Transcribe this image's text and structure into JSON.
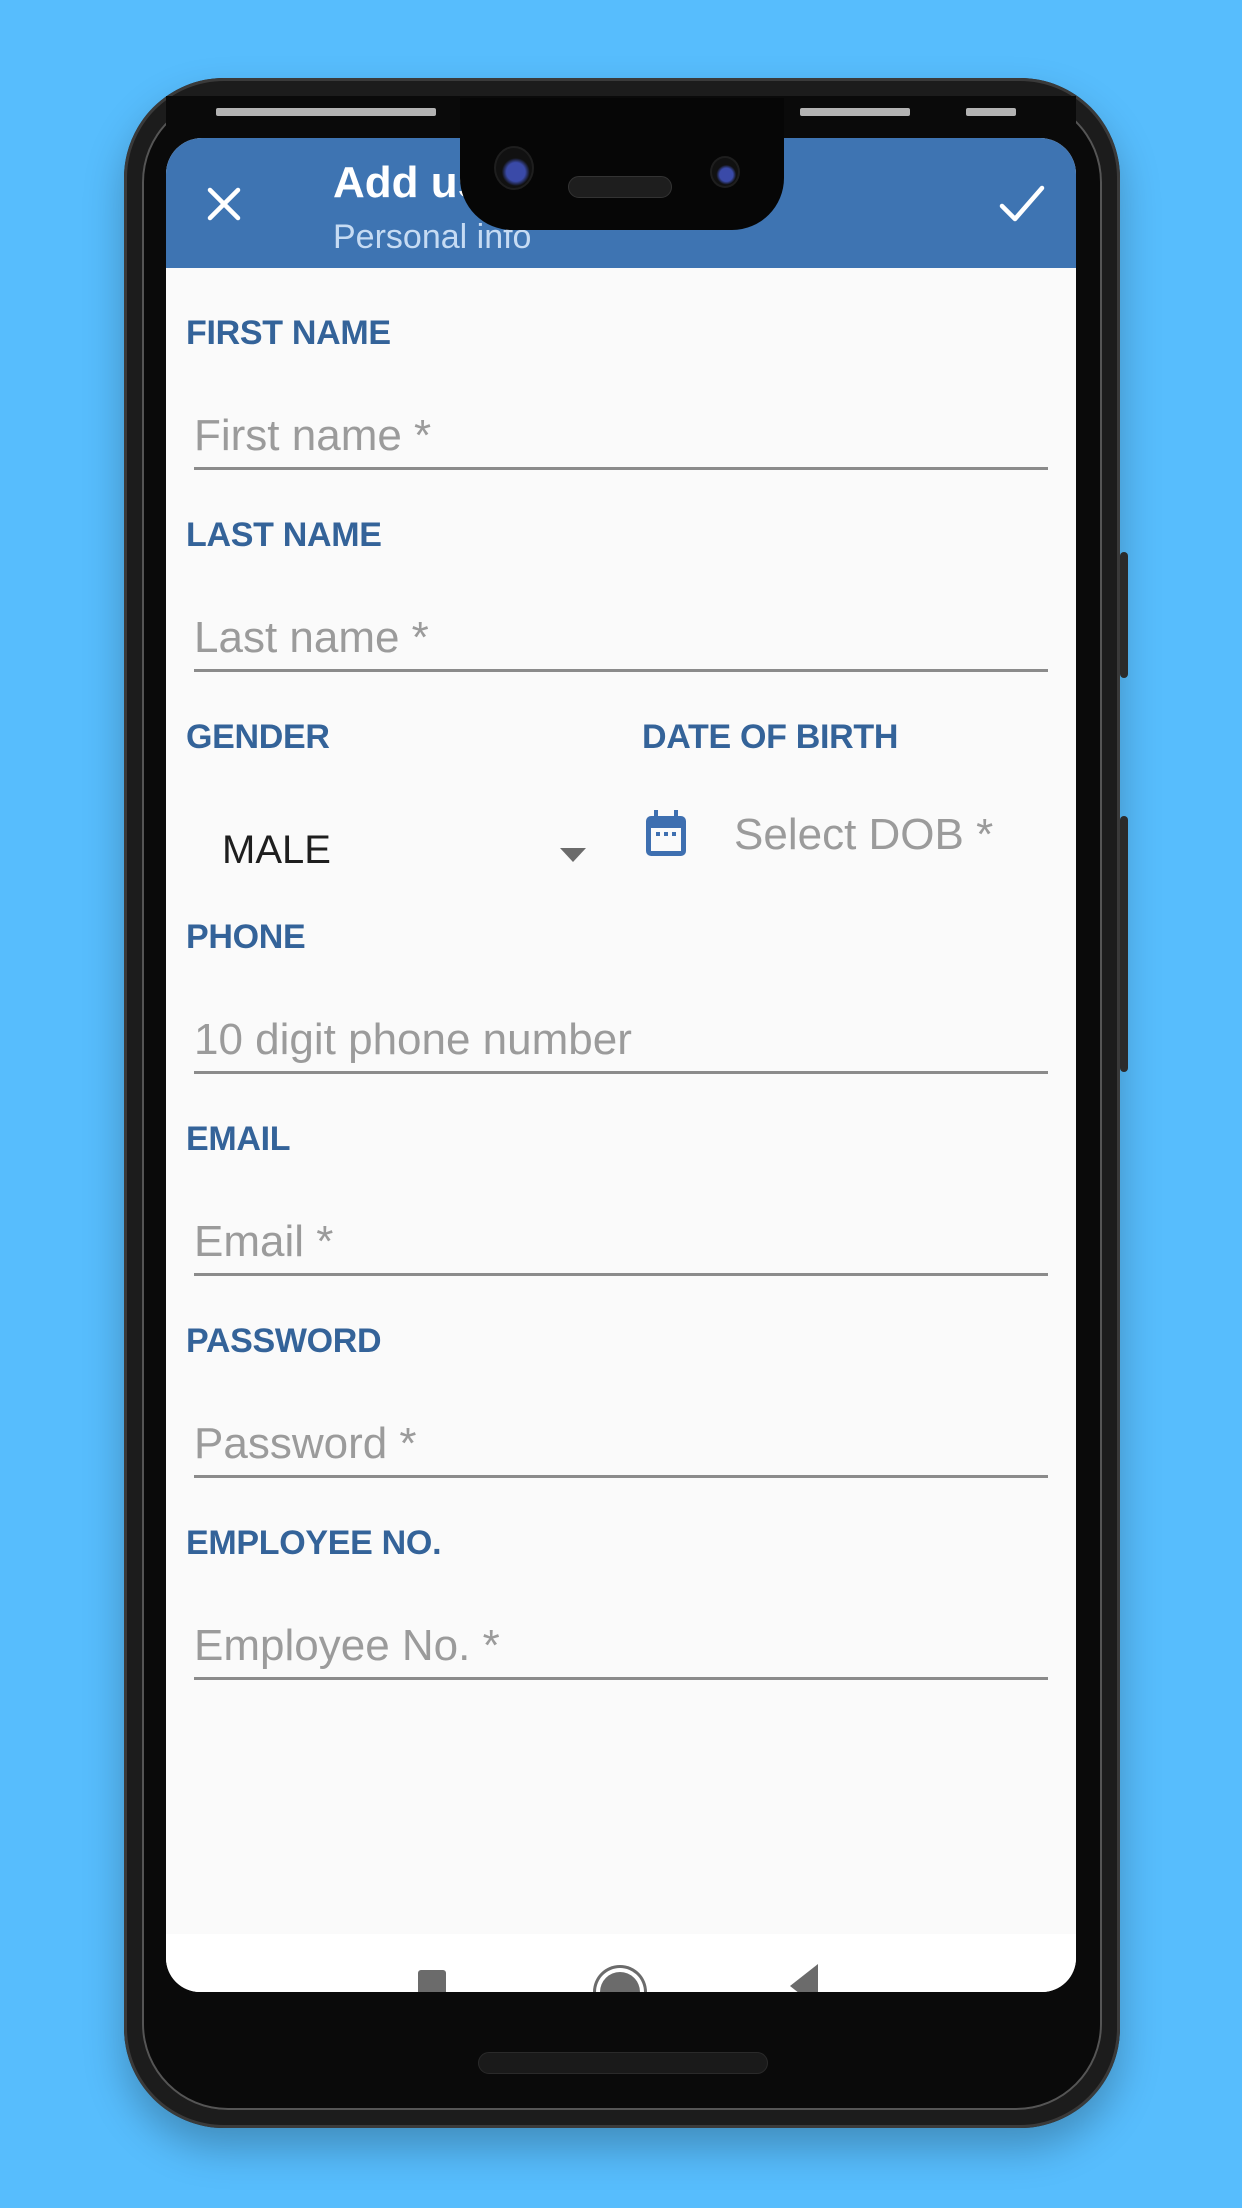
{
  "appbar": {
    "title": "Add us",
    "subtitle": "Personal info",
    "close_icon": "close-icon",
    "done_icon": "check-icon"
  },
  "form": {
    "first_name": {
      "label": "FIRST NAME",
      "placeholder": "First name *",
      "value": ""
    },
    "last_name": {
      "label": "LAST NAME",
      "placeholder": "Last name *",
      "value": ""
    },
    "gender": {
      "label": "GENDER",
      "value": "MALE"
    },
    "dob": {
      "label": "DATE OF BIRTH",
      "placeholder": "Select DOB *",
      "icon": "calendar-icon"
    },
    "phone": {
      "label": "PHONE",
      "placeholder": "10 digit phone number",
      "value": ""
    },
    "email": {
      "label": "EMAIL",
      "placeholder": "Email *",
      "value": ""
    },
    "password": {
      "label": "PASSWORD",
      "placeholder": "Password *",
      "value": ""
    },
    "employee_no": {
      "label": "EMPLOYEE NO.",
      "placeholder": "Employee No. *",
      "value": ""
    }
  },
  "navbar": {
    "recent_icon": "recent-apps-icon",
    "home_icon": "home-icon",
    "back_icon": "back-icon"
  },
  "colors": {
    "background": "#57bdfd",
    "appbar": "#3e74b2",
    "label": "#346399",
    "placeholder": "#9b9b9b"
  }
}
